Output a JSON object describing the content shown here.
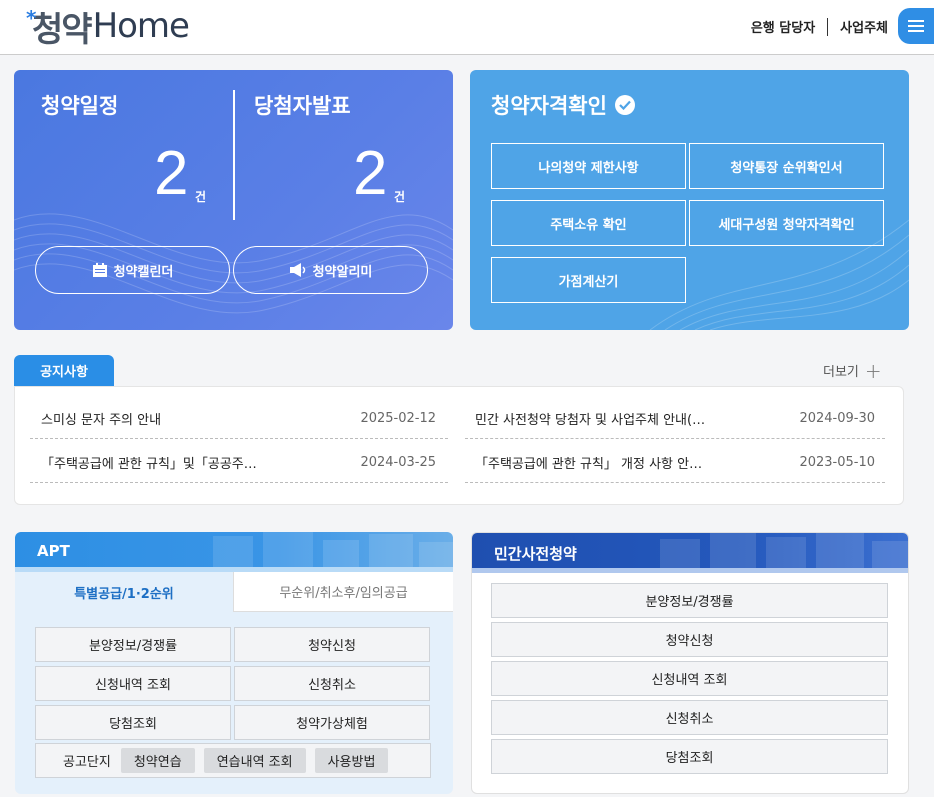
{
  "header": {
    "logo_korean": "청약",
    "logo_english": "Home",
    "nav": [
      "은행 담당자",
      "사업주체"
    ]
  },
  "schedule": {
    "left_title": "청약일정",
    "left_count": "2",
    "left_unit": "건",
    "right_title": "당첨자발표",
    "right_count": "2",
    "right_unit": "건",
    "calendar_label": "청약캘린더",
    "alarm_label": "청약알리미"
  },
  "eligibility": {
    "title": "청약자격확인",
    "buttons": [
      "나의청약 제한사항",
      "청약통장 순위확인서",
      "주택소유 확인",
      "세대구성원 청약자격확인",
      "가점계산기"
    ]
  },
  "notice": {
    "tab_label": "공지사항",
    "more_label": "더보기",
    "items": [
      {
        "title": "스미싱 문자 주의 안내",
        "date": "2025-02-12"
      },
      {
        "title": "민간 사전청약 당첨자 및 사업주체 안내(…",
        "date": "2024-09-30"
      },
      {
        "title": "「주택공급에 관한 규칙」및「공공주…",
        "date": "2024-03-25"
      },
      {
        "title": "「주택공급에 관한 규칙」 개정 사항 안…",
        "date": "2023-05-10"
      }
    ]
  },
  "apt": {
    "title": "APT",
    "tab_active": "특별공급/1·2순위",
    "tab_inactive": "무순위/취소후/임의공급",
    "buttons": [
      "분양정보/경쟁률",
      "청약신청",
      "신청내역 조회",
      "신청취소",
      "당첨조회",
      "청약가상체험"
    ],
    "row_label": "공고단지",
    "chips": [
      "청약연습",
      "연습내역 조회",
      "사용방법"
    ]
  },
  "private": {
    "title": "민간사전청약",
    "buttons": [
      "분양정보/경쟁률",
      "청약신청",
      "신청내역 조회",
      "신청취소",
      "당첨조회"
    ]
  }
}
